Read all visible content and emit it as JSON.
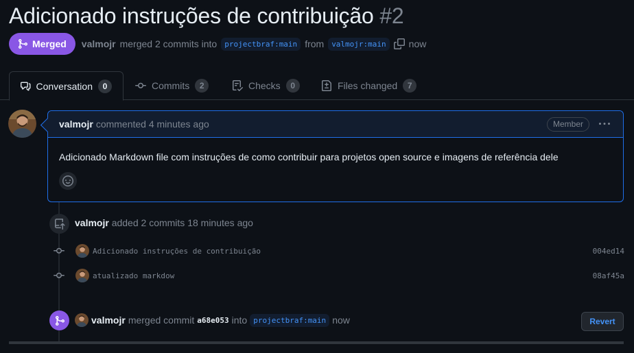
{
  "pr": {
    "title": "Adicionado instruções de contribuição",
    "number": "#2",
    "status": "Merged",
    "author": "valmojr",
    "merged_text": "merged 2 commits into",
    "base_branch": "projectbraf:main",
    "from_text": "from",
    "head_branch": "valmojr:main",
    "time": "now"
  },
  "tabs": [
    {
      "label": "Conversation",
      "count": "0",
      "icon": "comment-discussion-icon"
    },
    {
      "label": "Commits",
      "count": "2",
      "icon": "git-commit-icon"
    },
    {
      "label": "Checks",
      "count": "0",
      "icon": "checklist-icon"
    },
    {
      "label": "Files changed",
      "count": "7",
      "icon": "file-diff-icon"
    }
  ],
  "comment": {
    "author": "valmojr",
    "action": "commented 4 minutes ago",
    "role": "Member",
    "body": "Adicionado Markdown file com instruções de como contribuir para projetos open source e imagens de referência dele"
  },
  "commits_event": {
    "author": "valmojr",
    "text": "added 2 commits 18 minutes ago",
    "commits": [
      {
        "message": "Adicionado instruções de contribuição",
        "sha": "004ed14"
      },
      {
        "message": "atualizado markdow",
        "sha": "08af45a"
      }
    ]
  },
  "merge_event": {
    "author": "valmojr",
    "text_before": "merged commit",
    "sha": "a68e053",
    "text_into": "into",
    "branch": "projectbraf:main",
    "time": "now",
    "revert_label": "Revert"
  },
  "colors": {
    "background": "#0d1117",
    "merged": "#8957e5",
    "accent_blue": "#1f6feb",
    "link": "#4493f8"
  }
}
